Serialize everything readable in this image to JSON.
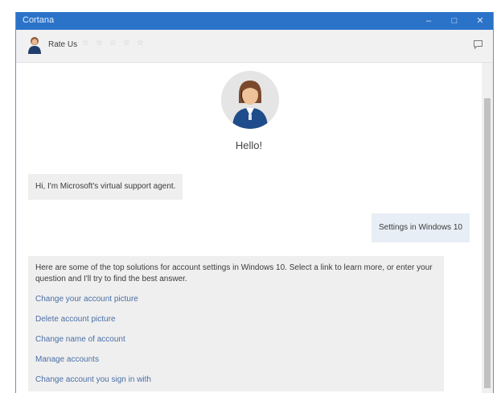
{
  "window": {
    "title": "Cortana"
  },
  "toolbar": {
    "rate_label": "Rate Us",
    "stars": [
      "☆",
      "☆",
      "☆",
      "☆",
      "☆"
    ]
  },
  "chat": {
    "greeting": "Hello!",
    "bot_intro": "Hi, I'm Microsoft's virtual support agent.",
    "user_message": "Settings in Windows 10",
    "solutions_text": "Here are some of the top solutions for account settings in Windows 10. Select a link to learn more, or enter your question and I'll try to find the best answer.",
    "links": [
      "Change your account picture",
      "Delete account picture",
      "Change name of account",
      "Manage accounts",
      "Change account you sign in with"
    ]
  },
  "colors": {
    "titlebar": "#2b73c8",
    "link": "#4a6fa5",
    "bubble": "#efefef",
    "user_bubble": "#e8eef5"
  }
}
